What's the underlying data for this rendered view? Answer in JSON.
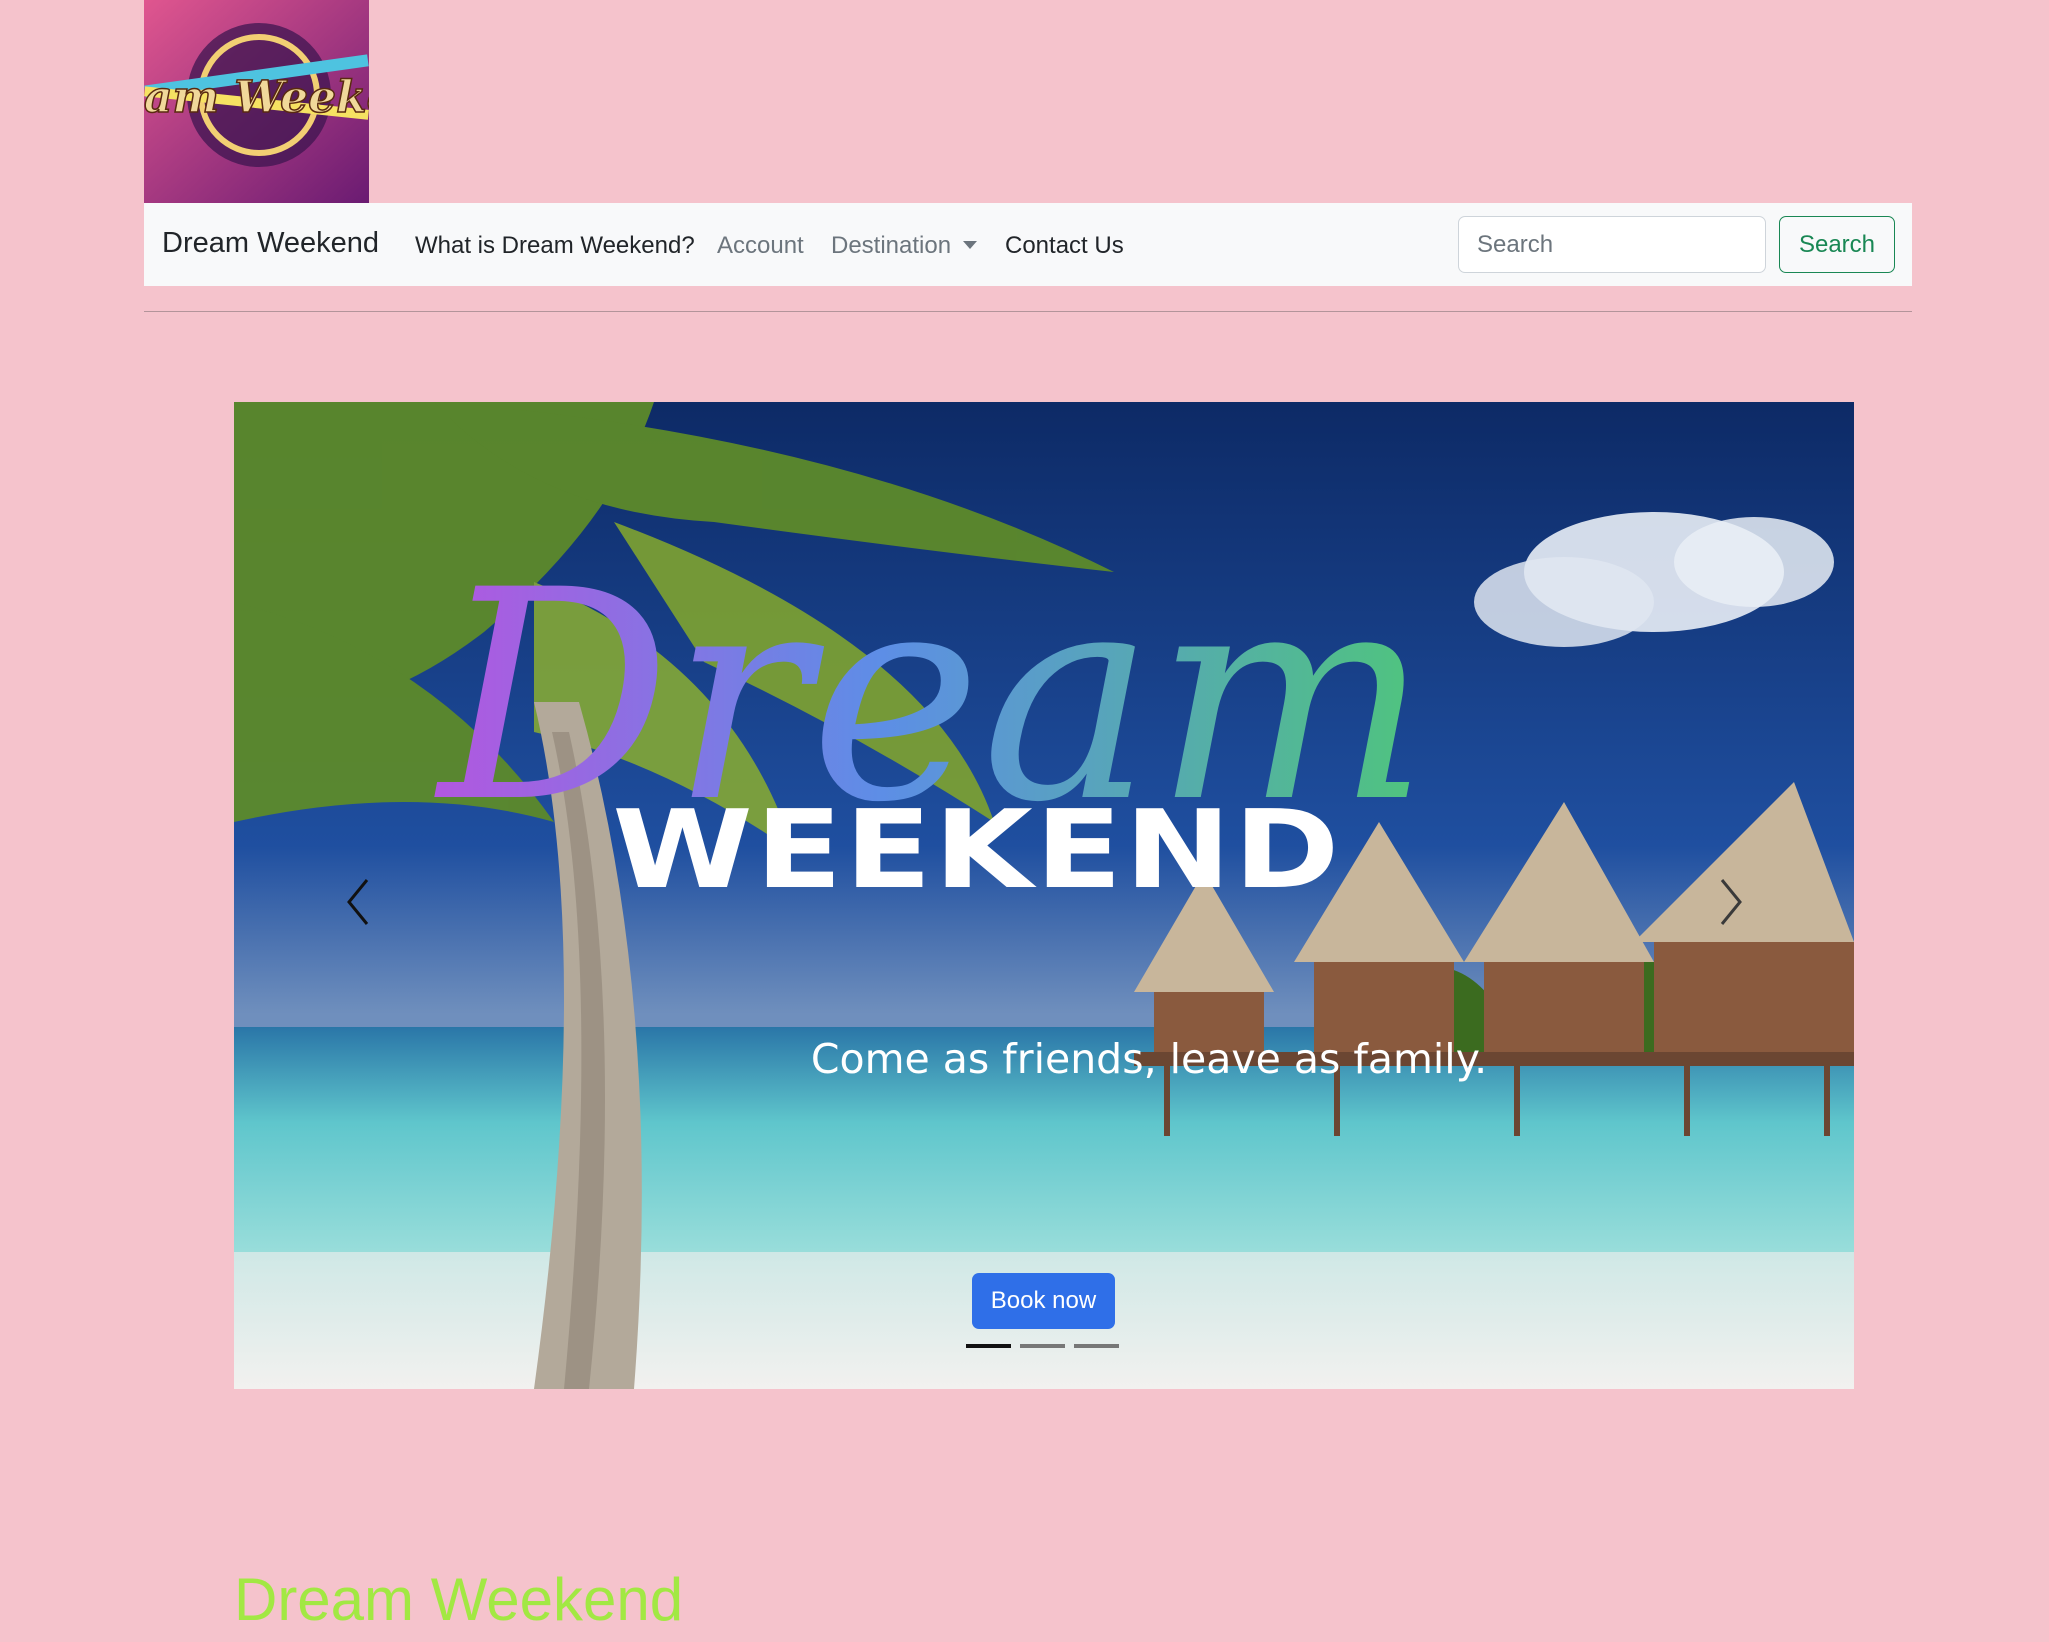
{
  "logo": {
    "text": "Dream Weekend",
    "icon": "dream-weekend-logo"
  },
  "navbar": {
    "brand": "Dream Weekend",
    "links": [
      {
        "label": "What is Dream Weekend?",
        "state": "active"
      },
      {
        "label": "Account",
        "state": "muted"
      },
      {
        "label": "Destination",
        "state": "muted",
        "dropdown": true
      },
      {
        "label": "Contact Us",
        "state": "active"
      }
    ],
    "search": {
      "placeholder": "Search",
      "value": "",
      "button_label": "Search"
    }
  },
  "hero": {
    "script_title": "Dream",
    "block_title": "WEEKEND",
    "tagline": "Come as friends, leave as family.",
    "cta_label": "Book now",
    "slide_count": 3,
    "active_slide": 1,
    "prev_icon": "chevron-left-icon",
    "next_icon": "chevron-right-icon"
  },
  "section": {
    "title": "Dream Weekend"
  },
  "colors": {
    "page_bg": "#f5c3cc",
    "navbar_bg": "#f8f9fa",
    "success": "#198754",
    "primary": "#2f6fe8",
    "section_title": "#a2e843"
  }
}
